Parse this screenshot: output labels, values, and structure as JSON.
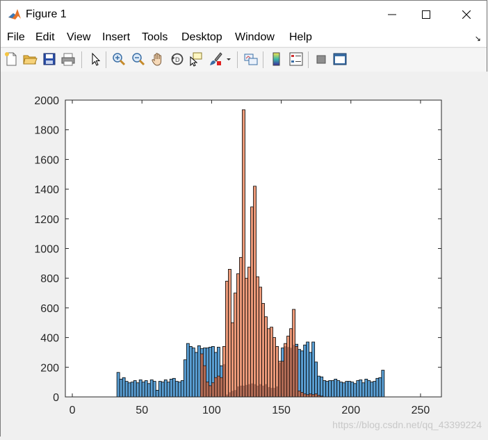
{
  "window": {
    "title": "Figure 1",
    "controls": [
      "minimize-icon",
      "maximize-icon",
      "close-icon"
    ]
  },
  "menu": {
    "items": [
      "File",
      "Edit",
      "View",
      "Insert",
      "Tools",
      "Desktop",
      "Window",
      "Help"
    ]
  },
  "toolbar": {
    "buttons": [
      "new-figure-icon",
      "open-file-icon",
      "save-icon",
      "print-icon",
      "select-arrow-icon",
      "zoom-in-icon",
      "zoom-out-icon",
      "pan-hand-icon",
      "rotate-3d-icon",
      "data-cursor-icon",
      "brush-icon",
      "link-plot-icon",
      "colorbar-icon",
      "legend-icon",
      "hide-tools-icon",
      "show-tools-icon"
    ]
  },
  "watermark": "https://blog.csdn.net/qq_43399224",
  "chart_data": {
    "type": "bar",
    "title": "",
    "xlabel": "",
    "ylabel": "",
    "xlim": [
      -5,
      265
    ],
    "ylim": [
      0,
      2000
    ],
    "xticks": [
      0,
      50,
      100,
      150,
      200,
      250
    ],
    "yticks": [
      0,
      200,
      400,
      600,
      800,
      1000,
      1200,
      1400,
      1600,
      1800,
      2000
    ],
    "grid": false,
    "bin_width": 2,
    "colors": {
      "series1": "#5a9fd4",
      "series2": "#e9906e",
      "overlap": "#8b4a3a",
      "edge": "#000000"
    },
    "series": [
      {
        "x": [
          32,
          34,
          36,
          38,
          40,
          42,
          44,
          46,
          48,
          50,
          52,
          54,
          56,
          58,
          60,
          62,
          64,
          66,
          68,
          70,
          72,
          74,
          76,
          78,
          80,
          82,
          84,
          86,
          88,
          90,
          92,
          94,
          96,
          98,
          100,
          102,
          104,
          106,
          108,
          110,
          112,
          114,
          116,
          118,
          120,
          122,
          124,
          126,
          128,
          130,
          132,
          134,
          136,
          138,
          140,
          142,
          144,
          146,
          148,
          150,
          152,
          154,
          156,
          158,
          160,
          162,
          164,
          166,
          168,
          170,
          172,
          174,
          176,
          178,
          180,
          182,
          184,
          186,
          188,
          190,
          192,
          194,
          196,
          198,
          200,
          202,
          204,
          206,
          208,
          210,
          212,
          214,
          216,
          218,
          220,
          222
        ],
        "values": [
          165,
          120,
          130,
          105,
          95,
          100,
          110,
          95,
          115,
          100,
          110,
          90,
          115,
          105,
          45,
          105,
          100,
          115,
          100,
          120,
          125,
          105,
          100,
          110,
          250,
          360,
          340,
          330,
          300,
          345,
          325,
          330,
          330,
          335,
          340,
          300,
          335,
          210,
          220,
          15,
          30,
          40,
          45,
          70,
          75,
          75,
          80,
          85,
          90,
          85,
          75,
          85,
          75,
          85,
          65,
          60,
          60,
          70,
          230,
          330,
          340,
          335,
          330,
          350,
          355,
          320,
          310,
          350,
          370,
          300,
          370,
          235,
          140,
          135,
          110,
          105,
          110,
          110,
          120,
          110,
          100,
          95,
          105,
          105,
          100,
          90,
          110,
          115,
          95,
          120,
          110,
          100,
          105,
          125,
          130,
          180
        ]
      },
      {
        "x": [
          92,
          94,
          96,
          98,
          100,
          102,
          104,
          106,
          108,
          110,
          112,
          114,
          116,
          118,
          120,
          122,
          124,
          126,
          128,
          130,
          132,
          134,
          136,
          138,
          140,
          142,
          144,
          146,
          148,
          150,
          152,
          154,
          156,
          158,
          160,
          162,
          164,
          166,
          168,
          170,
          172,
          174,
          176,
          178
        ],
        "values": [
          290,
          210,
          100,
          75,
          95,
          130,
          140,
          130,
          340,
          780,
          860,
          500,
          700,
          830,
          940,
          1935,
          800,
          875,
          1280,
          1420,
          810,
          740,
          630,
          540,
          460,
          470,
          400,
          340,
          240,
          240,
          360,
          410,
          460,
          590,
          340,
          40,
          30,
          20,
          15,
          20,
          15,
          20,
          10,
          5
        ]
      }
    ]
  }
}
